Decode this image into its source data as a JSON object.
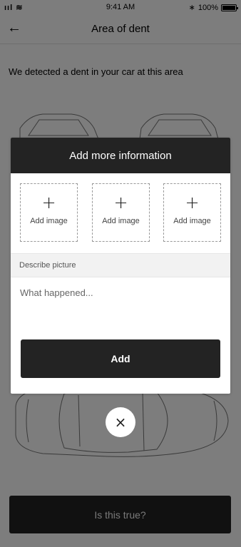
{
  "status": {
    "signal": "ııl ≋",
    "time": "9:41 AM",
    "bluetooth": "∗",
    "battery": "100%"
  },
  "header": {
    "back_icon": "arrow-left-icon",
    "title": "Area of dent"
  },
  "main": {
    "detect_text": "We detected a dent in your car at this area",
    "cta_label": "Is this true?"
  },
  "modal": {
    "title": "Add more information",
    "image_slots": [
      {
        "icon": "+",
        "label": "Add image"
      },
      {
        "icon": "+",
        "label": "Add image"
      },
      {
        "icon": "+",
        "label": "Add image"
      }
    ],
    "describe_label": "Describe picture",
    "describe_placeholder": "What happened...",
    "add_label": "Add"
  },
  "close_icon": "×"
}
